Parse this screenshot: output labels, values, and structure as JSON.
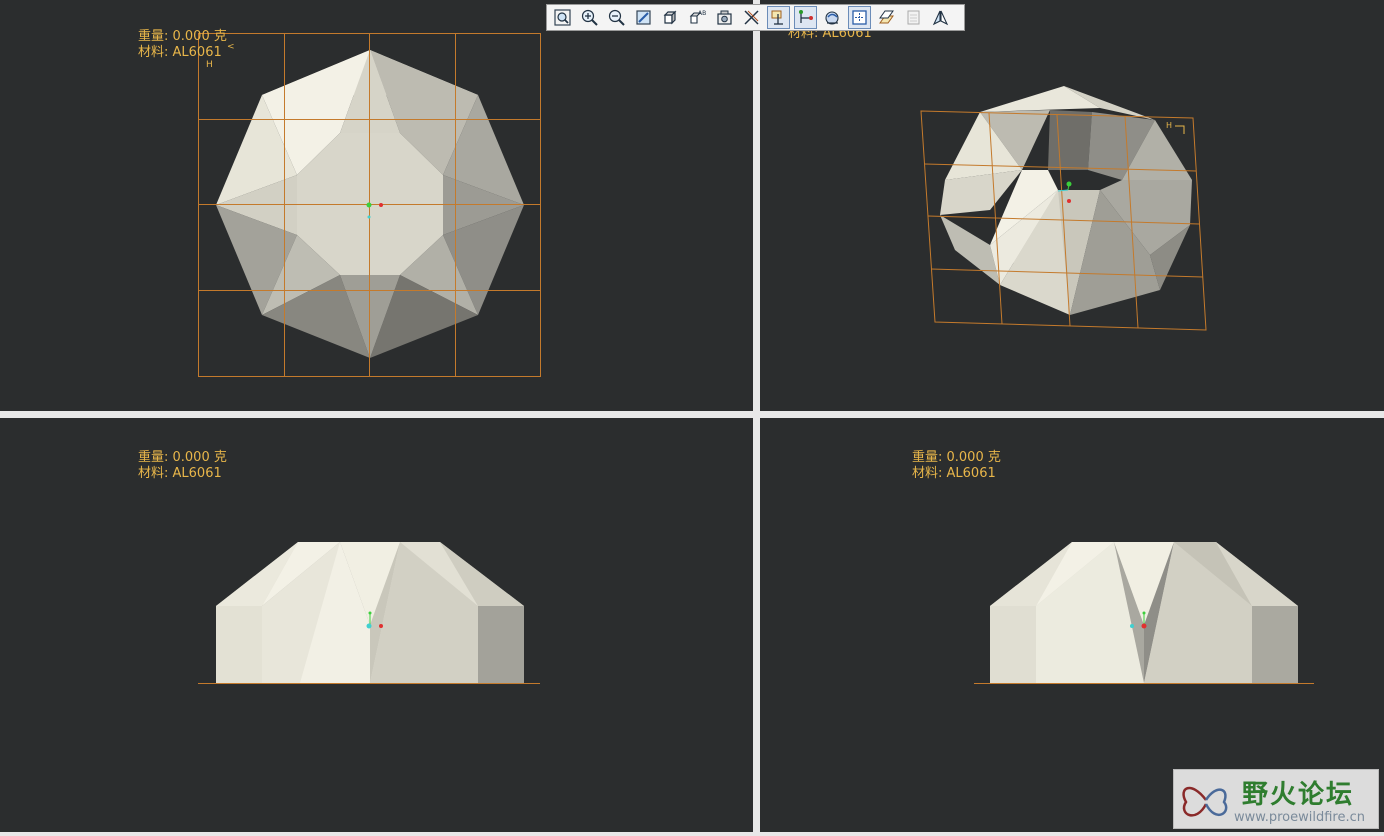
{
  "viewports": {
    "top_left": {
      "weight": "重量: 0.000 克",
      "material": "材料: AL6061"
    },
    "top_right": {
      "material": "材料: AL6061"
    },
    "bottom_left": {
      "weight": "重量: 0.000 克",
      "material": "材料: AL6061"
    },
    "bottom_right": {
      "weight": "重量: 0.000 克",
      "material": "材料: AL6061"
    }
  },
  "toolbar": {
    "buttons": [
      {
        "icon": "zoom-window-icon",
        "pressed": false
      },
      {
        "icon": "zoom-in-icon",
        "pressed": false
      },
      {
        "icon": "zoom-out-icon",
        "pressed": false
      },
      {
        "icon": "repaint-icon",
        "pressed": false
      },
      {
        "icon": "display-style-icon",
        "pressed": false
      },
      {
        "icon": "saved-views-icon",
        "pressed": false
      },
      {
        "icon": "view-manager-icon",
        "pressed": false
      },
      {
        "icon": "datum-planes-icon",
        "pressed": false
      },
      {
        "icon": "datum-axes-icon",
        "pressed": true
      },
      {
        "icon": "datum-points-icon",
        "pressed": true
      },
      {
        "icon": "coordinate-systems-icon",
        "pressed": false
      },
      {
        "icon": "spin-center-icon",
        "pressed": true
      },
      {
        "icon": "annotation-display-icon",
        "pressed": false
      },
      {
        "icon": "layer-icon",
        "pressed": false
      },
      {
        "icon": "model-tree-icon",
        "pressed": false
      }
    ]
  },
  "watermark": {
    "title": "野火论坛",
    "url": "www.proewildfire.cn"
  },
  "colors": {
    "viewport_bg": "#2b2d2e",
    "info_text": "#e8b64a",
    "grid_line": "#c47a2c",
    "model_light": "#f1efe3",
    "model_mid": "#c9c7bb",
    "model_dark": "#8d8c85"
  }
}
